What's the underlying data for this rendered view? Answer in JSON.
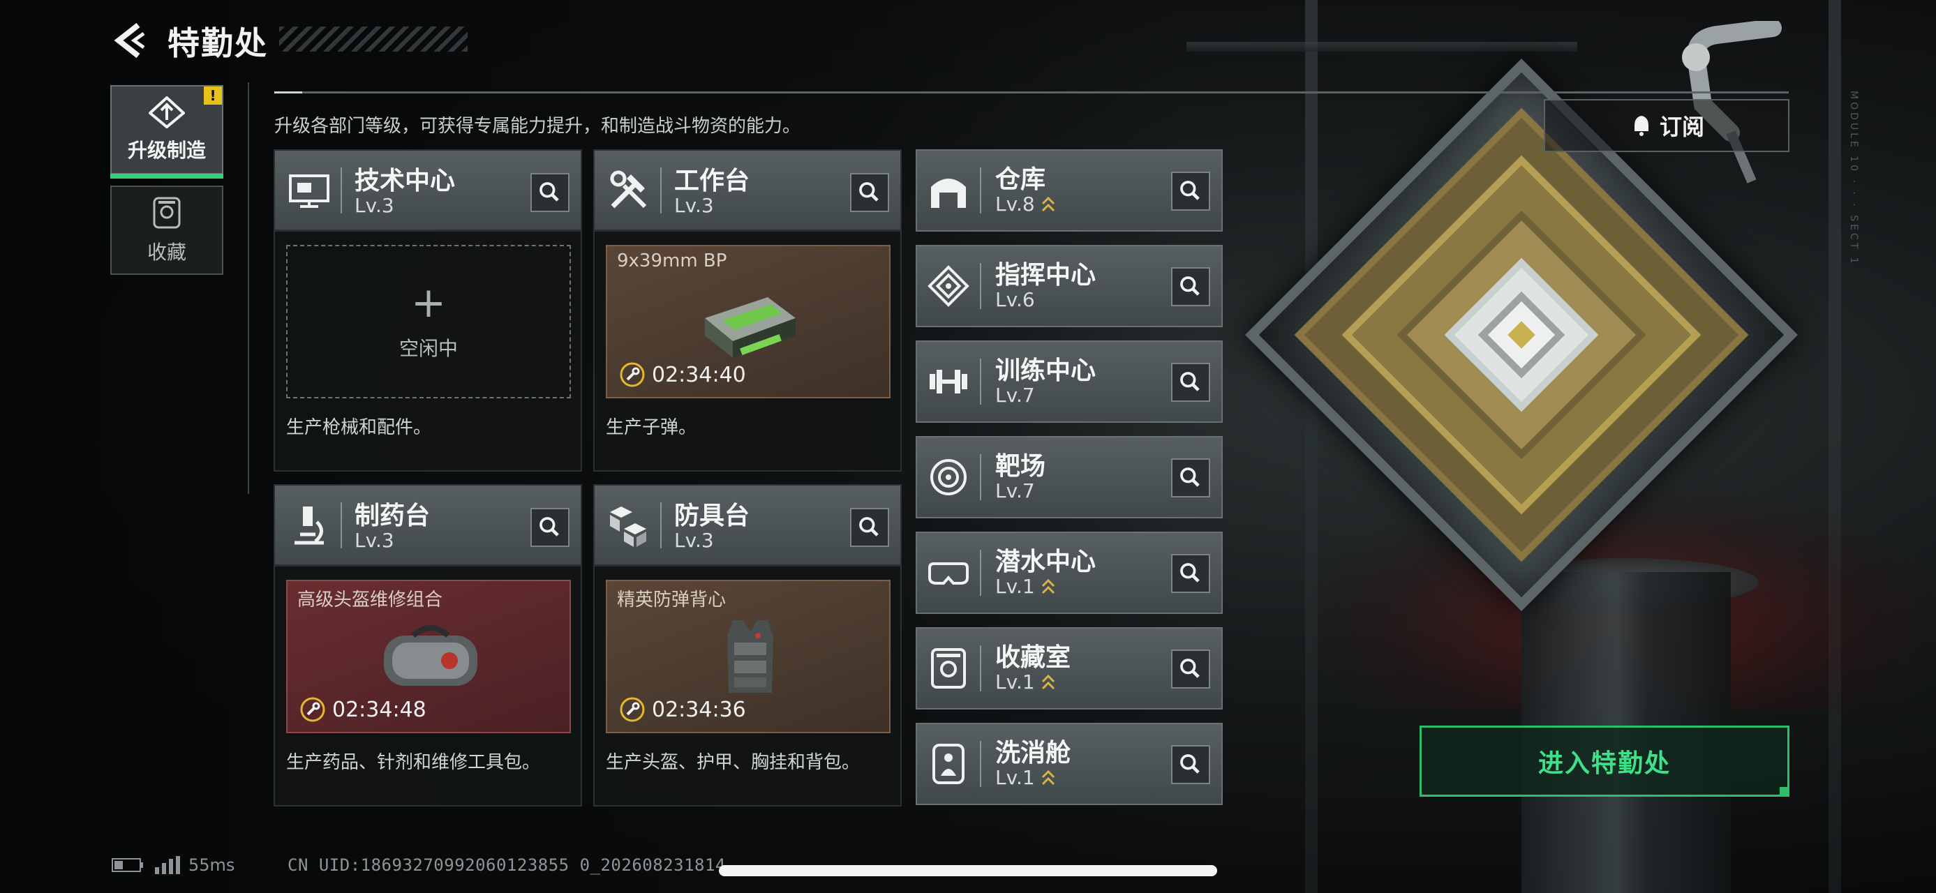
{
  "header": {
    "title": "特勤处"
  },
  "subtitle": "升级各部门等级，可获得专属能力提升，和制造战斗物资的能力。",
  "side_tabs": [
    {
      "label": "升级制造",
      "badge": "!",
      "active": true
    },
    {
      "label": "收藏",
      "active": false
    }
  ],
  "subscribe_label": "订阅",
  "enter_label": "进入特勤处",
  "big_departments": [
    {
      "name": "技术中心",
      "level": "Lv.3",
      "icon": "monitor-icon",
      "slot": {
        "state": "idle",
        "label": "空闲中"
      },
      "desc": "生产枪械和配件。"
    },
    {
      "name": "工作台",
      "level": "Lv.3",
      "icon": "tools-icon",
      "slot": {
        "state": "producing",
        "item": "9x39mm BP",
        "timer": "02:34:40",
        "item_icon": "ammo-box-icon"
      },
      "desc": "生产子弹。"
    },
    {
      "name": "制药台",
      "level": "Lv.3",
      "icon": "microscope-icon",
      "slot": {
        "state": "producing",
        "item": "高级头盔维修组合",
        "timer": "02:34:48",
        "item_icon": "repair-bag-icon"
      },
      "desc": "生产药品、针剂和维修工具包。"
    },
    {
      "name": "防具台",
      "level": "Lv.3",
      "icon": "armor-blocks-icon",
      "slot": {
        "state": "producing",
        "item": "精英防弹背心",
        "timer": "02:34:36",
        "item_icon": "vest-icon"
      },
      "desc": "生产头盔、护甲、胸挂和背包。"
    }
  ],
  "small_departments": [
    {
      "name": "仓库",
      "level": "Lv.8",
      "icon": "warehouse-icon",
      "upgradable": true
    },
    {
      "name": "指挥中心",
      "level": "Lv.6",
      "icon": "chip-icon",
      "upgradable": false
    },
    {
      "name": "训练中心",
      "level": "Lv.7",
      "icon": "dumbbell-icon",
      "upgradable": false
    },
    {
      "name": "靶场",
      "level": "Lv.7",
      "icon": "target-icon",
      "upgradable": false
    },
    {
      "name": "潜水中心",
      "level": "Lv.1",
      "icon": "goggles-icon",
      "upgradable": true
    },
    {
      "name": "收藏室",
      "level": "Lv.1",
      "icon": "vault-icon",
      "upgradable": true
    },
    {
      "name": "洗消舱",
      "level": "Lv.1",
      "icon": "decon-pod-icon",
      "upgradable": true
    }
  ],
  "status": {
    "ping": "55ms",
    "uid": "CN UID:18693270992060123855 0_202608231814"
  },
  "colors": {
    "accent_green": "#37d07e",
    "warning_yellow": "#e8c21a",
    "upgrade_gold": "#d9b24a"
  }
}
